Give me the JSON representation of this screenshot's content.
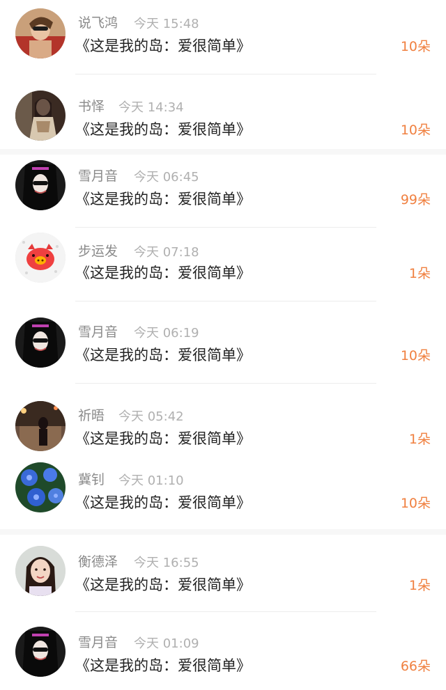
{
  "items": [
    {
      "name": "说飞鸿",
      "time": "今天 15:48",
      "title": "《这是我的岛：爱很简单》",
      "count": "10朵",
      "avatar": "avatar-woman-sunglasses"
    },
    {
      "name": "书怿",
      "time": "今天 14:34",
      "title": "《这是我的岛：爱很简单》",
      "count": "10朵",
      "avatar": "avatar-woman-dress"
    },
    {
      "name": "雪月音",
      "time": "今天 06:45",
      "title": "《这是我的岛：爱很简单》",
      "count": "99朵",
      "avatar": "avatar-dark-sunglasses"
    },
    {
      "name": "步运发",
      "time": "今天 07:18",
      "title": "《这是我的岛：爱很简单》",
      "count": "1朵",
      "avatar": "avatar-pig"
    },
    {
      "name": "雪月音",
      "time": "今天 06:19",
      "title": "《这是我的岛：爱很简单》",
      "count": "10朵",
      "avatar": "avatar-dark-sunglasses"
    },
    {
      "name": "祈晤",
      "time": "今天 05:42",
      "title": "《这是我的岛：爱很简单》",
      "count": "1朵",
      "avatar": "avatar-night-street"
    },
    {
      "name": "冀钊",
      "time": "今天 01:10",
      "title": "《这是我的岛：爱很简单》",
      "count": "10朵",
      "avatar": "avatar-blue-flowers"
    },
    {
      "name": "衡德泽",
      "time": "今天 16:55",
      "title": "《这是我的岛：爱很简单》",
      "count": "1朵",
      "avatar": "avatar-girl-portrait"
    },
    {
      "name": "雪月音",
      "time": "今天 01:09",
      "title": "《这是我的岛：爱很简单》",
      "count": "66朵",
      "avatar": "avatar-dark-sunglasses"
    }
  ],
  "colors": {
    "name": "#8a8a8a",
    "time": "#b0b0b0",
    "title": "#222222",
    "count": "#f08040"
  }
}
